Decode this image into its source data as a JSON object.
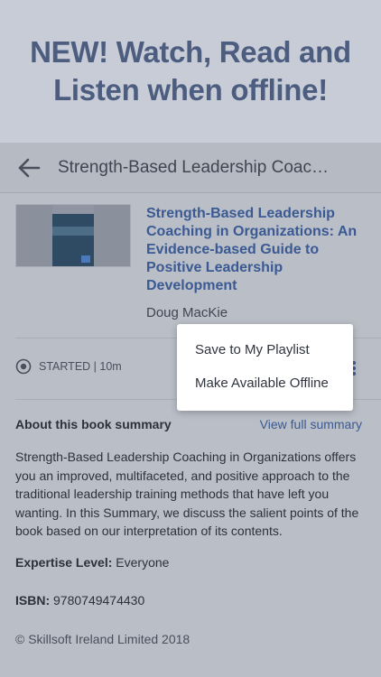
{
  "promo": {
    "headline": "NEW! Watch, Read and Listen when offline!"
  },
  "appbar": {
    "back_icon": "arrow-left-icon",
    "title": "Strength-Based Leadership Coaching in Organizations: An Evidence-based Guide to Positive Leadership Development"
  },
  "book": {
    "cover_icon": "book-cover",
    "title": "Strength-Based Leadership Coaching in Organizations: An Evidence-based Guide to Positive Leadership Development",
    "author": "Doug MacKie"
  },
  "status": {
    "icon": "radio-target-icon",
    "text": "STARTED | 10m"
  },
  "menu": {
    "items": [
      {
        "label": "Save to My Playlist"
      },
      {
        "label": "Make Available Offline"
      }
    ]
  },
  "about": {
    "label": "About this book summary",
    "view_full": "View full summary",
    "summary": "Strength-Based Leadership Coaching in Organizations offers you an improved, multifaceted, and positive approach to the traditional leadership training methods that have left you wanting. In this Summary, we discuss the salient points of the book based on our interpretation of its contents."
  },
  "details": {
    "expertise_label": "Expertise Level:",
    "expertise_value": "Everyone",
    "isbn_label": "ISBN:",
    "isbn_value": "9780749474430",
    "copyright": "© Skillsoft Ireland Limited 2018"
  },
  "colors": {
    "accent": "#3b5a93",
    "promo_text": "#4d5d80"
  }
}
